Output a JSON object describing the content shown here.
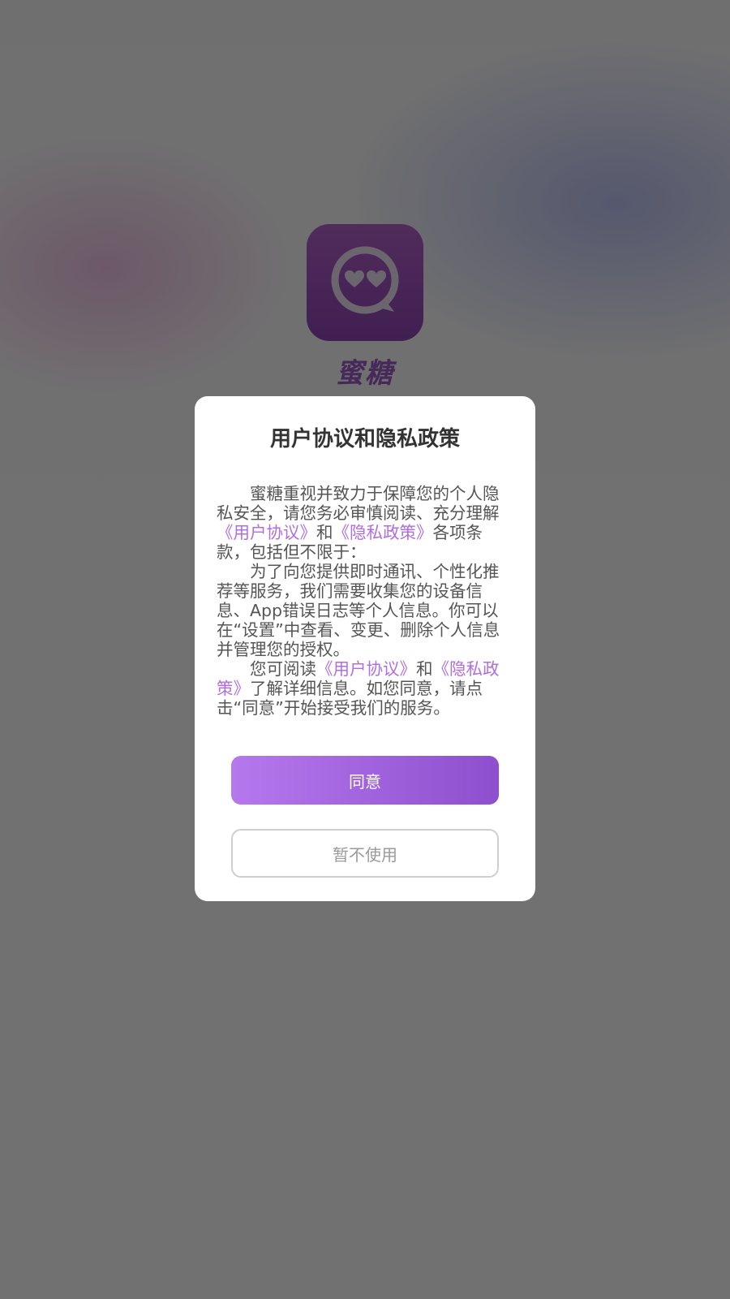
{
  "splash": {
    "app_name": "蜜糖",
    "icon": "chat-bubble-hearts-icon"
  },
  "dialog": {
    "title": "用户协议和隐私政策",
    "paragraphs": [
      {
        "p1_a": "蜜糖重视并致力于保障您的个人隐私安全，请您务必审慎阅读、充分理解",
        "p1_link1": "《用户协议》",
        "p1_b": "和",
        "p1_link2": "《隐私政策》",
        "p1_c": "各项条款，包括但不限于："
      },
      {
        "p2": "为了向您提供即时通讯、个性化推荐等服务，我们需要收集您的设备信息、App错误日志等个人信息。你可以在“设置”中查看、变更、删除个人信息并管理您的授权。"
      },
      {
        "p3_a": "您可阅读",
        "p3_link1": "《用户协议》",
        "p3_b": "和",
        "p3_link2": "《隐私政策》",
        "p3_c": "了解详细信息。如您同意，请点击“同意”开始接受我们的服务。"
      }
    ],
    "agree_label": "同意",
    "decline_label": "暂不使用"
  },
  "colors": {
    "accent": "#b06ee0",
    "agree_gradient_start": "#b678ed",
    "agree_gradient_end": "#8e4fce",
    "overlay": "rgba(0,0,0,0.54)"
  }
}
